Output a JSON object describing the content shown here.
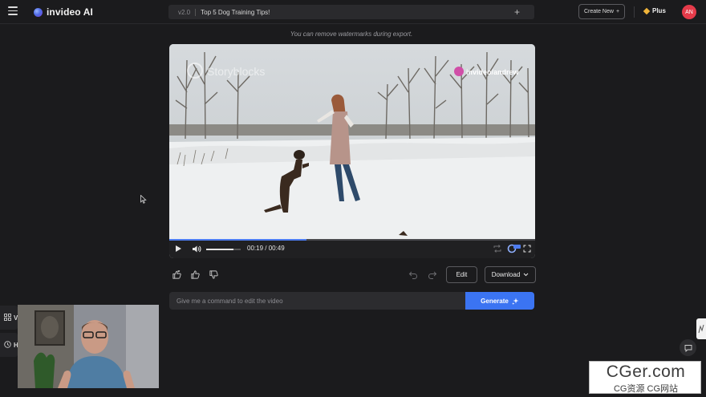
{
  "header": {
    "brand": "invideo AI",
    "version": "v2.0",
    "project_title": "Top 5 Dog Training Tips!",
    "create_new_label": "Create New",
    "plan_label": "Plus",
    "avatar_initials": "AN"
  },
  "notice": "You can remove watermarks during export.",
  "video": {
    "watermark_source": "Storyblocks",
    "watermark_handle": "invideo/andrew",
    "time_display": "00:19 / 00:49",
    "progress_fraction": 0.376,
    "volume_fraction": 0.78
  },
  "actions": {
    "edit_label": "Edit",
    "download_label": "Download"
  },
  "command": {
    "placeholder": "Give me a command to edit the video",
    "generate_label": "Generate"
  },
  "side_tabs": [
    {
      "label": "V",
      "icon": "grid-icon"
    },
    {
      "label": "H",
      "icon": "clock-icon"
    }
  ],
  "site_badge": {
    "domain": "CGer.com",
    "subtitle": "CG资源 CG网站"
  },
  "colors": {
    "accent": "#3b74f2",
    "avatar": "#e53b4a",
    "plan": "#f0b43a",
    "background": "#1b1b1d"
  }
}
